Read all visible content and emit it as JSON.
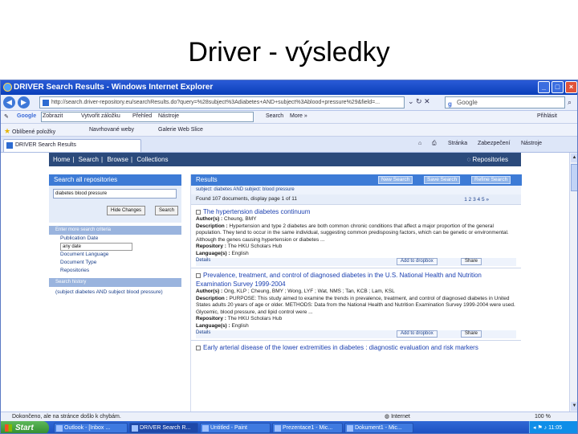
{
  "slide": {
    "title": "Driver - výsledky"
  },
  "window": {
    "title": "DRIVER Search Results - Windows Internet Explorer",
    "buttons": {
      "minimize": "_",
      "maximize": "□",
      "close": "×"
    }
  },
  "address": {
    "url": "http://search.driver-repository.eu/searchResults.do?query=%28subject%3Adiabetes+AND+subject%3Ablood+pressure%29&field=...",
    "search_engine": "Google"
  },
  "google_bar": {
    "logo": "Google",
    "items": [
      "Zobrazit",
      "Vytvořit záložku",
      "Přehled",
      "Nástroje"
    ],
    "search_label": "Search",
    "more_label": "More »",
    "signin_label": "Přihlásit"
  },
  "favorites": {
    "items": [
      "Oblíbené položky",
      "Navrhované weby",
      "Galerie Web Slice"
    ]
  },
  "tabs": {
    "active_label": "DRIVER Search Results",
    "tools": [
      "Stránka",
      "Zabezpečení",
      "Nástroje"
    ]
  },
  "site": {
    "nav": [
      "Home",
      "Search",
      "Browse",
      "Collections"
    ],
    "separator": "|",
    "repositories_label": "Repositories"
  },
  "left": {
    "search_header": "Search all repositories",
    "query": "diabetes blood pressure",
    "refine_button": "Hide Changes",
    "search_button": "Search",
    "refine_bar": "Enter more search criteria",
    "facet_date": "Publication Date",
    "date_value": "any date",
    "facet_language": "Document Language",
    "facet_type": "Document Type",
    "facet_repos": "Repositories",
    "history_bar": "Search history",
    "history_entry": "(subject diabetes AND subject blood pressure)"
  },
  "results": {
    "header": "Results",
    "buttons": {
      "new": "New Search",
      "save": "Save Search",
      "refine": "Refine Search"
    },
    "breadcrumb": "subject: diabetes AND subject: blood pressure",
    "found_text": "Found 107 documents, display page 1 of 11",
    "pager": "1 2 3 4 5 »",
    "labels": {
      "author": "Author(s) :",
      "description": "Description :",
      "repository": "Repository :",
      "language": "Language(s) :"
    },
    "action_labels": {
      "details": "Details",
      "dropbox": "Add to dropbox",
      "share": "Share"
    },
    "items": [
      {
        "title": "The hypertension diabetes continuum",
        "authors": "Cheung, BMY",
        "description": "Hypertension and type 2 diabetes are both common chronic conditions that affect a major proportion of the general population. They tend to occur in the same individual, suggesting common predisposing factors, which can be genetic or environmental. Although the genes causing hypertension or diabetes ...",
        "repository": "The HKU Scholars Hub",
        "language": "English"
      },
      {
        "title": "Prevalence, treatment, and control of diagnosed diabetes in the U.S. National Health and Nutrition Examination Survey 1999-2004",
        "authors": "Ong, KLP ; Cheung, BMY ; Wong, LYF ; Wat, NMS ; Tan, KCB ; Lam, KSL",
        "description": "PURPOSE: This study aimed to examine the trends in prevalence, treatment, and control of diagnosed diabetes in United States adults 20 years of age or older. METHODS: Data from the National Health and Nutrition Examination Survey 1999-2004 were used. Glycemic, blood pressure, and lipid control were ...",
        "repository": "The HKU Scholars Hub",
        "language": "English"
      },
      {
        "title": "Early arterial disease of the lower extremities in diabetes : diagnostic evaluation and risk markers"
      }
    ]
  },
  "status": {
    "text": "Dokončeno, ale na stránce došlo k chybám.",
    "zone": "Internet",
    "zoom": "100 %"
  },
  "taskbar": {
    "start": "Start",
    "tasks": [
      "Outlook - [Inbox ...",
      "DRIVER Search R...",
      "Untitled - Paint",
      "Prezentace1 - Mic...",
      "Dokument1 - Mic..."
    ],
    "clock": "11:05"
  }
}
